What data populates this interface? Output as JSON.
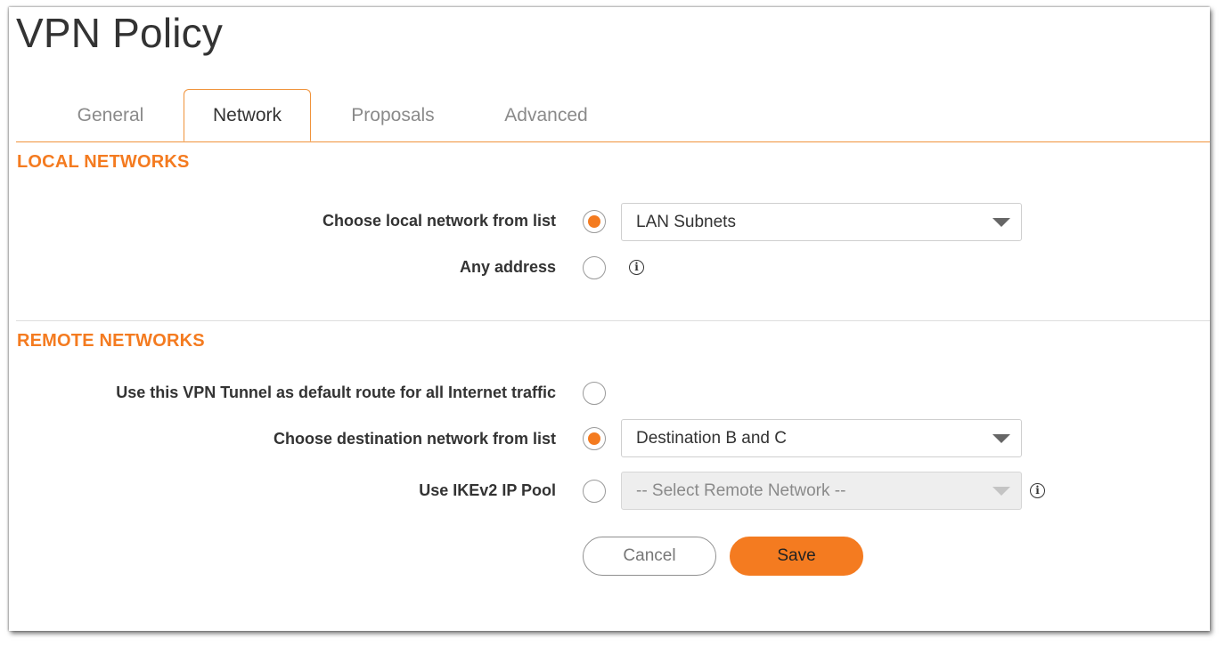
{
  "window": {
    "title": "VPN Policy"
  },
  "tabs": [
    {
      "label": "General"
    },
    {
      "label": "Network",
      "active": true
    },
    {
      "label": "Proposals"
    },
    {
      "label": "Advanced"
    }
  ],
  "local_networks": {
    "heading": "LOCAL NETWORKS",
    "choose_label": "Choose local network from list",
    "choose_selected": true,
    "choose_value": "LAN Subnets",
    "any_label": "Any address",
    "any_selected": false
  },
  "remote_networks": {
    "heading": "REMOTE NETWORKS",
    "default_route_label": "Use this VPN Tunnel as default route for all Internet traffic",
    "default_route_selected": false,
    "destination_label": "Choose destination network from list",
    "destination_selected": true,
    "destination_value": "Destination B and C",
    "ikev2_label": "Use IKEv2 IP Pool",
    "ikev2_selected": false,
    "ikev2_placeholder": "-- Select Remote Network --"
  },
  "buttons": {
    "cancel": "Cancel",
    "save": "Save"
  },
  "icons": {
    "info": "info-icon",
    "dropdown": "chevron-down-icon"
  },
  "colors": {
    "accent": "#f47b20",
    "tab_border": "#f0933b"
  }
}
